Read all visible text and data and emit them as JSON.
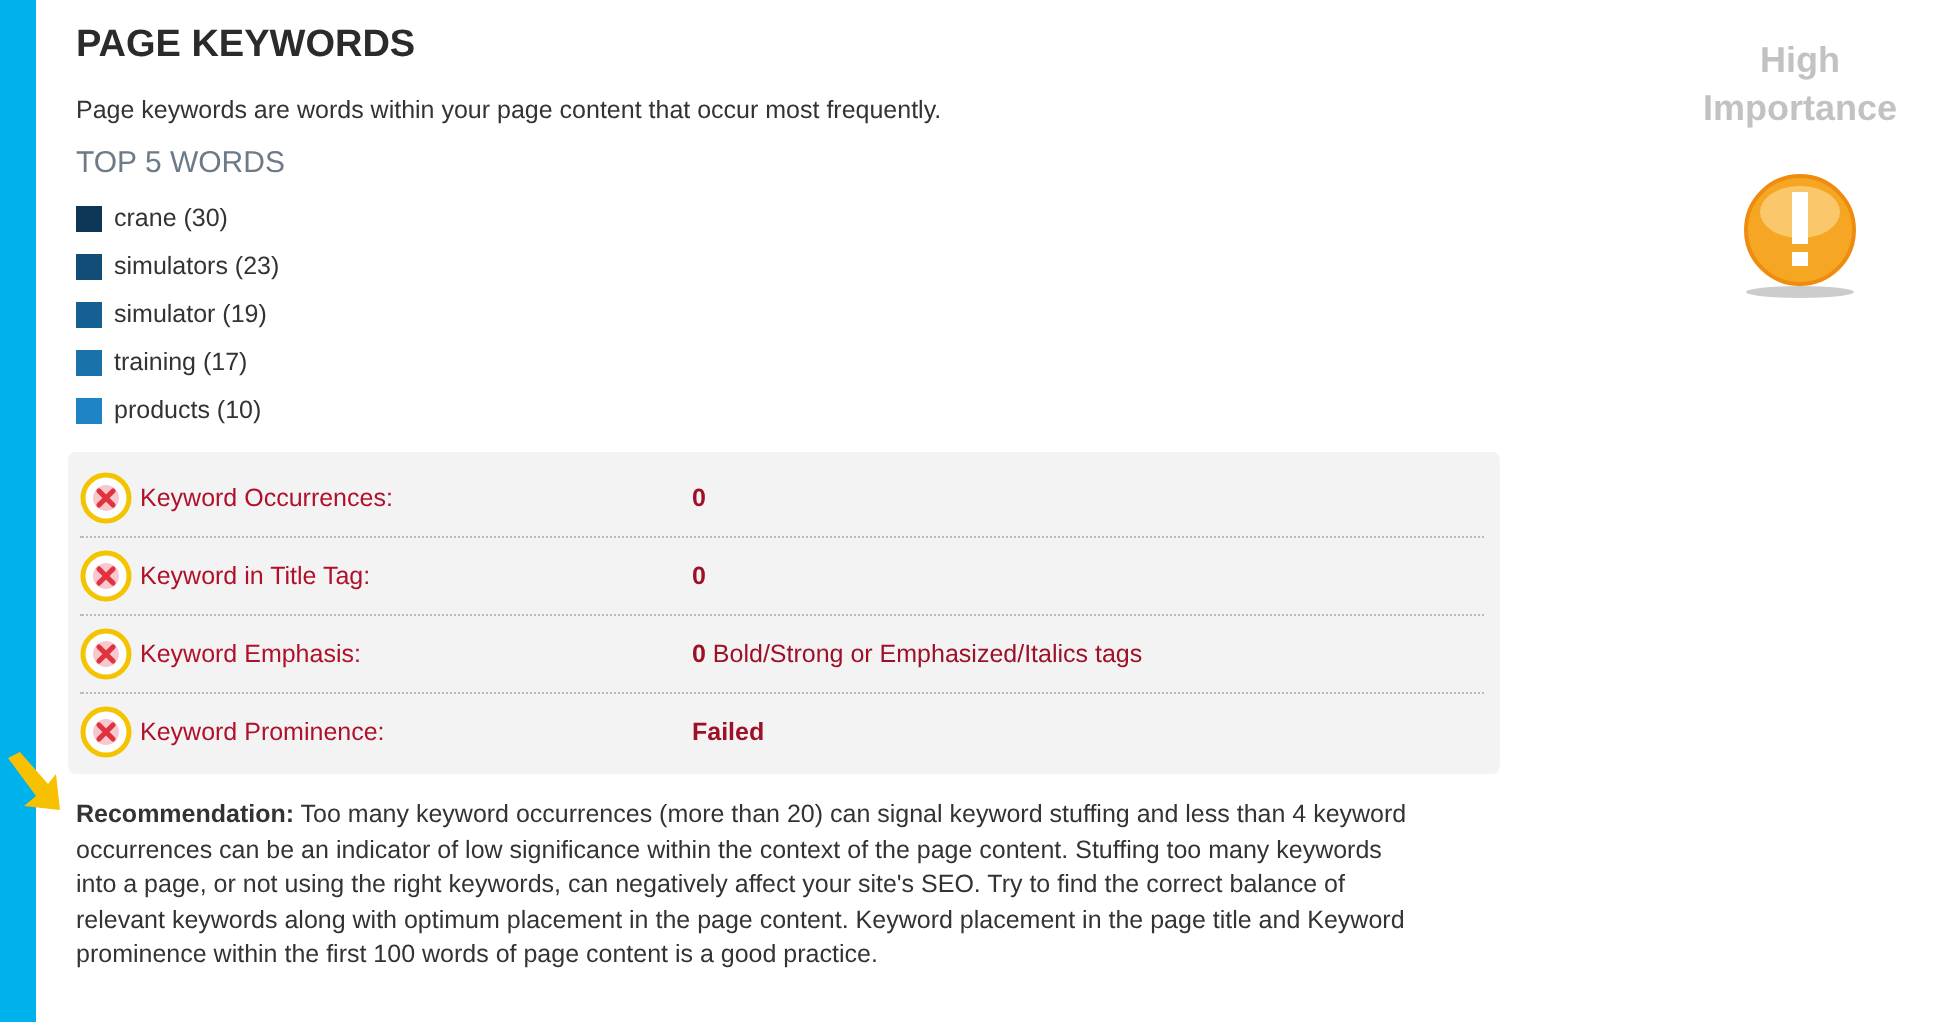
{
  "title": "PAGE KEYWORDS",
  "description": "Page keywords are words within your page content that occur most frequently.",
  "top_words": {
    "heading": "TOP 5 WORDS",
    "items": [
      {
        "word": "crane (30)",
        "color": "#0d3556"
      },
      {
        "word": "simulators (23)",
        "color": "#124d78"
      },
      {
        "word": "simulator (19)",
        "color": "#155f92"
      },
      {
        "word": "training (17)",
        "color": "#1a72ab"
      },
      {
        "word": "products (10)",
        "color": "#1f84c6"
      }
    ]
  },
  "checks": [
    {
      "label": "Keyword Occurrences:",
      "value": "**0**",
      "passed": false
    },
    {
      "label": "Keyword in Title Tag:",
      "value": "**0**",
      "passed": false
    },
    {
      "label": "Keyword Emphasis:",
      "value": "**0** Bold/Strong or Emphasized/Italics tags",
      "passed": false
    },
    {
      "label": "Keyword Prominence:",
      "value": "**Failed**",
      "passed": false
    }
  ],
  "recommendation": "**Recommendation:** Too many keyword occurrences (more than 20) can signal keyword stuffing and less than 4 keyword occurrences can be an indicator of low significance within the context of the page content. Stuffing too many keywords into a page, or not using the right keywords, can negatively affect your site's SEO. Try to find the correct balance of relevant keywords along with optimum placement in the page content. Keyword placement in the page title and Keyword prominence within the first 100 words of page content is a good practice.",
  "importance": {
    "line1": "High",
    "line2": "Importance"
  }
}
